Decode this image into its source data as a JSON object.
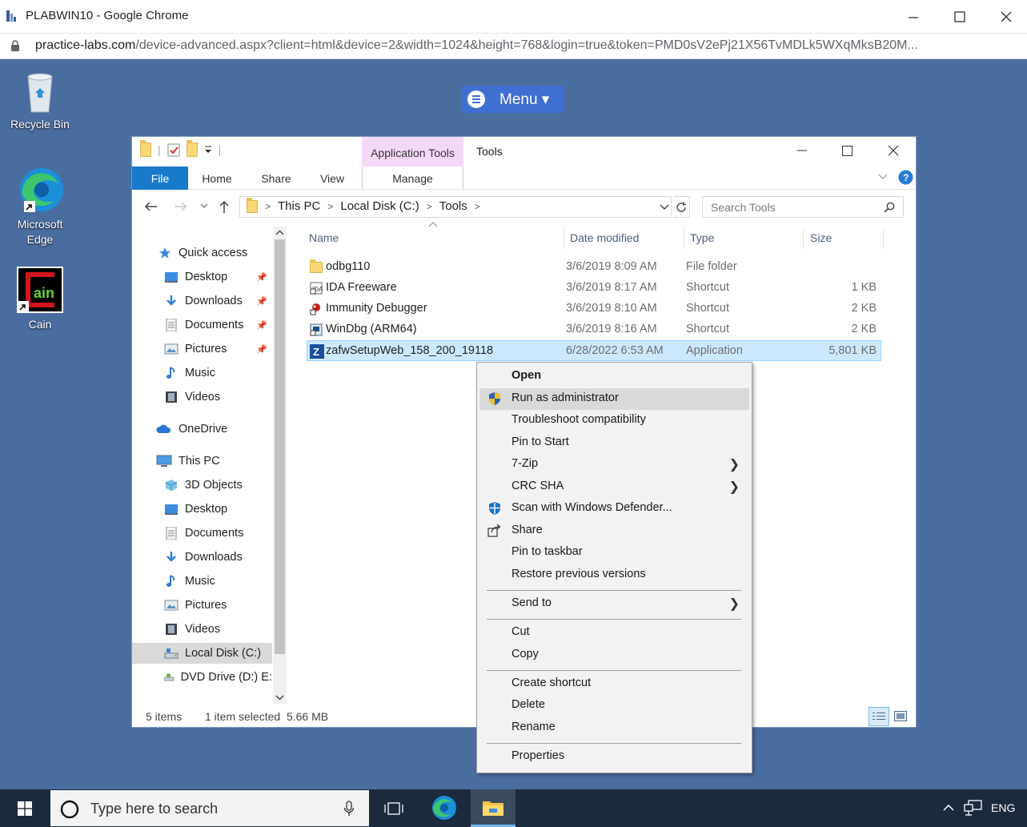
{
  "browser": {
    "title": "PLABWIN10 - Google Chrome",
    "url_host": "practice-labs.com",
    "url_rest": "/device-advanced.aspx?client=html&device=2&width=1024&height=768&login=true&token=PMD0sV2ePj21X56TvMDLk5WXqMksB20M..."
  },
  "desktop": {
    "icons": [
      {
        "label": "Recycle Bin"
      },
      {
        "label": "Microsoft Edge"
      },
      {
        "label": "Cain"
      }
    ],
    "menu_label": "Menu ▾"
  },
  "explorer": {
    "contextual_tab": "Application Tools",
    "title": "Tools",
    "ribbon_tabs": [
      "File",
      "Home",
      "Share",
      "View",
      "Manage"
    ],
    "breadcrumbs": [
      "This PC",
      "Local Disk (C:)",
      "Tools"
    ],
    "search_placeholder": "Search Tools",
    "nav": [
      {
        "label": "Quick access"
      },
      {
        "label": "Desktop"
      },
      {
        "label": "Downloads"
      },
      {
        "label": "Documents"
      },
      {
        "label": "Pictures"
      },
      {
        "label": "Music"
      },
      {
        "label": "Videos"
      },
      {
        "label": "OneDrive"
      },
      {
        "label": "This PC"
      },
      {
        "label": "3D Objects"
      },
      {
        "label": "Desktop"
      },
      {
        "label": "Documents"
      },
      {
        "label": "Downloads"
      },
      {
        "label": "Music"
      },
      {
        "label": "Pictures"
      },
      {
        "label": "Videos"
      },
      {
        "label": "Local Disk (C:)"
      },
      {
        "label": "DVD Drive (D:) E:"
      }
    ],
    "columns": [
      "Name",
      "Date modified",
      "Type",
      "Size"
    ],
    "files": [
      {
        "name": "odbg110",
        "date": "3/6/2019 8:09 AM",
        "type": "File folder",
        "size": ""
      },
      {
        "name": "IDA Freeware",
        "date": "3/6/2019 8:17 AM",
        "type": "Shortcut",
        "size": "1 KB"
      },
      {
        "name": "Immunity Debugger",
        "date": "3/6/2019 8:10 AM",
        "type": "Shortcut",
        "size": "2 KB"
      },
      {
        "name": "WinDbg (ARM64)",
        "date": "3/6/2019 8:16 AM",
        "type": "Shortcut",
        "size": "2 KB"
      },
      {
        "name": "zafwSetupWeb_158_200_19118",
        "date": "6/28/2022 6:53 AM",
        "type": "Application",
        "size": "5,801 KB"
      }
    ],
    "status_items": "5 items",
    "status_selected": "1 item selected  5.66 MB"
  },
  "context_menu": {
    "items": [
      "Open",
      "Run as administrator",
      "Troubleshoot compatibility",
      "Pin to Start",
      "7-Zip",
      "CRC SHA",
      "Scan with Windows Defender...",
      "Share",
      "Pin to taskbar",
      "Restore previous versions",
      "Send to",
      "Cut",
      "Copy",
      "Create shortcut",
      "Delete",
      "Rename",
      "Properties"
    ]
  },
  "taskbar": {
    "search_placeholder": "Type here to search",
    "language": "ENG"
  },
  "colors": {
    "desktop_bg": "#4a6da0",
    "accent_blue": "#1979ca",
    "selection": "#cce8ff",
    "contextual_tab": "#f4d9f7"
  }
}
